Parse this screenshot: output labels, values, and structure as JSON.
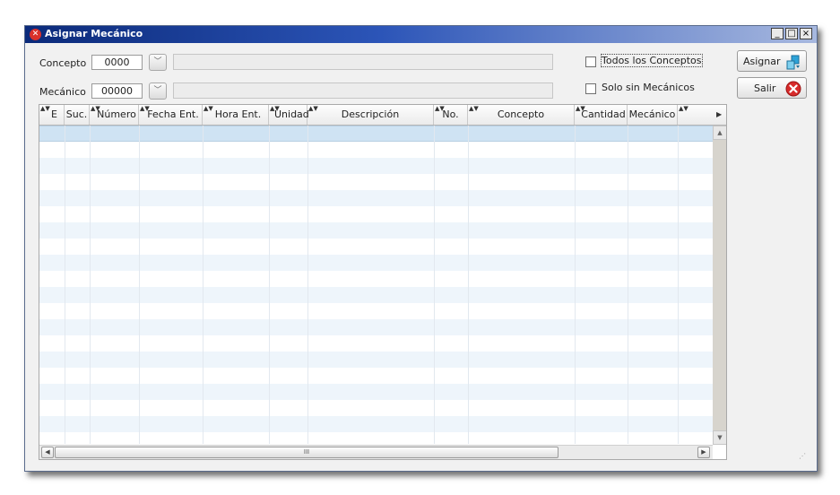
{
  "window": {
    "title": "Asignar Mecánico",
    "controls": {
      "minimize": "_",
      "maximize": "□",
      "close": "×"
    }
  },
  "filters": {
    "concepto": {
      "label": "Concepto",
      "value": "0000"
    },
    "mecanico": {
      "label": "Mecánico",
      "value": "00000"
    }
  },
  "options": {
    "todos_conceptos": {
      "label": "Todos los Conceptos",
      "checked": false
    },
    "solo_sin_mecanicos": {
      "label": "Solo sin Mecánicos",
      "checked": false
    }
  },
  "buttons": {
    "asignar": {
      "label": "Asignar",
      "icon": "assign-icon"
    },
    "salir": {
      "label": "Salir",
      "icon": "close-circle-icon"
    }
  },
  "grid": {
    "columns": [
      "E",
      "Suc.",
      "Número",
      "Fecha Ent.",
      "Hora Ent.",
      "Unidad",
      "Descripción",
      "No.",
      "Concepto",
      "Cantidad",
      "Mecánico"
    ],
    "rows": []
  },
  "scrollbar": {
    "thumb_grip": "III"
  },
  "colors": {
    "title_start": "#0b2a7a",
    "title_end": "#a7b8df",
    "row_alt": "#eef5fb",
    "row_selected": "#cfe3f3"
  }
}
